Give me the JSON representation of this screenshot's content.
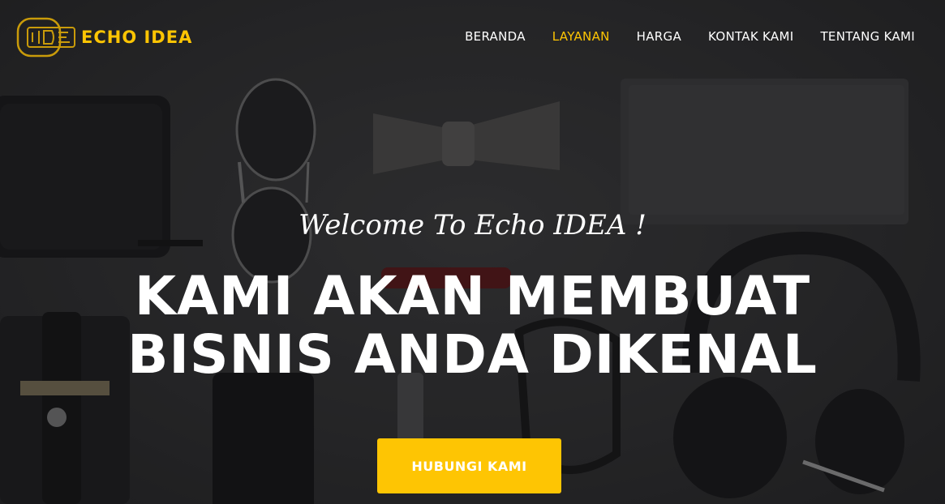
{
  "brand": {
    "name": "ECHO IDEA",
    "logo_icon": "echo-idea-logo-icon",
    "accent_color": "#fec503"
  },
  "nav": {
    "items": [
      {
        "label": "BERANDA",
        "active": false
      },
      {
        "label": "LAYANAN",
        "active": true
      },
      {
        "label": "HARGA",
        "active": false
      },
      {
        "label": "KONTAK KAMI",
        "active": false
      },
      {
        "label": "TENTANG KAMI",
        "active": false
      }
    ]
  },
  "hero": {
    "intro": "Welcome To Echo IDEA !",
    "heading_line1": "KAMI AKAN MEMBUAT",
    "heading_line2": "BISNIS ANDA DIKENAL",
    "cta_label": "HUBUNGI KAMI",
    "background_image": "flat-lay-accessories-photo"
  }
}
